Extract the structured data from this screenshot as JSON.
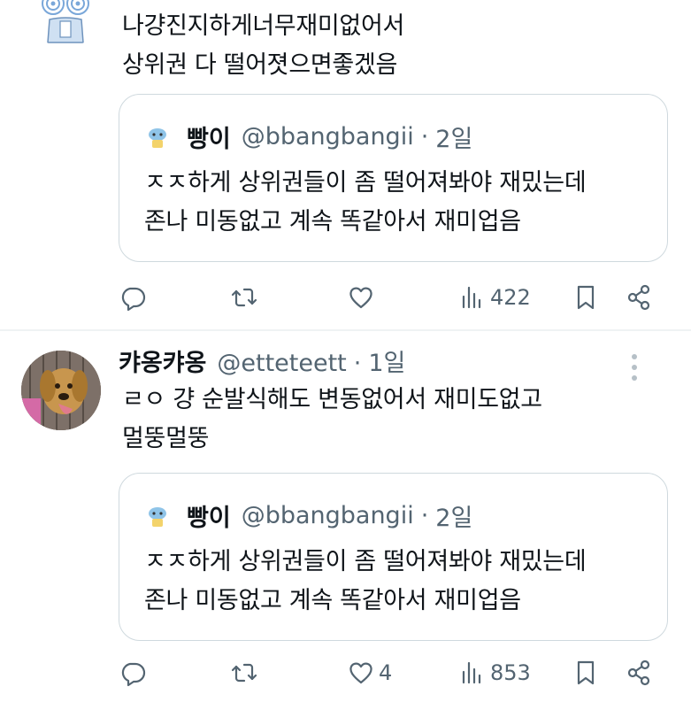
{
  "tweets": [
    {
      "name": "",
      "handle": "",
      "time": "",
      "lines": [
        "나걍진지하게너무재미없어서",
        "상위권 다 떨어졋으면좋겠음"
      ],
      "quote": {
        "name": "빵이",
        "handle": "@bbangbangii",
        "dot": "·",
        "time": "2일",
        "lines": [
          "ㅈㅈ하게 상위권들이 좀 떨어져봐야 재밌는데",
          "존나 미동없고 계속 똑같아서 재미업음"
        ]
      },
      "actions": {
        "replies": "",
        "retweets": "",
        "likes": "",
        "views": "422"
      }
    },
    {
      "name": "캬옹캬옹",
      "handle": "@etteteett",
      "dot": "·",
      "time": "1일",
      "lines": [
        "ㄹㅇ 걍 순발식해도 변동없어서 재미도없고",
        "멀뚱멀뚱"
      ],
      "quote": {
        "name": "빵이",
        "handle": "@bbangbangii",
        "dot": "·",
        "time": "2일",
        "lines": [
          "ㅈㅈ하게 상위권들이 좀 떨어져봐야 재밌는데",
          "존나 미동없고 계속 똑같아서 재미업음"
        ]
      },
      "actions": {
        "replies": "",
        "retweets": "",
        "likes": "4",
        "views": "853"
      }
    }
  ],
  "icons": {
    "reply": "reply-icon",
    "retweet": "retweet-icon",
    "like": "heart-icon",
    "views": "views-chart-icon",
    "bookmark": "bookmark-icon",
    "share": "share-icon",
    "more": "more-vertical-icon"
  },
  "colors": {
    "text": "#0f1419",
    "secondary": "#536471",
    "border": "#cfd9de",
    "divider": "#eff3f4"
  }
}
